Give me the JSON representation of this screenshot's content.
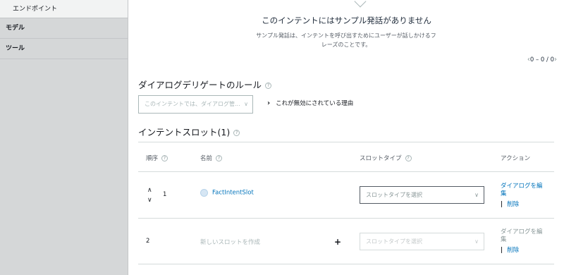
{
  "sidebar": {
    "items": [
      {
        "label": "エンドポイント"
      },
      {
        "label": "モデル"
      },
      {
        "label": "ツール"
      }
    ]
  },
  "empty_state": {
    "title": "このインテントにはサンプル発話がありません",
    "description": "サンプル発話は、インテントを呼び出すためにユーザーが話しかけるフレーズのことです。"
  },
  "pager": {
    "text": "0 – 0 / 0"
  },
  "dialog": {
    "title": "ダイアログデリゲートのルール",
    "select_placeholder": "このインテントでは、ダイアログ管...",
    "reason_label": "これが無効にされている理由"
  },
  "slots": {
    "title": "インテントスロット(1)",
    "headers": {
      "order": "順序",
      "name": "名前",
      "type": "スロットタイプ",
      "actions": "アクション"
    },
    "rows": [
      {
        "order": "1",
        "name": "FactIntentSlot",
        "type_placeholder": "スロットタイプを選択",
        "edit": "ダイアログを編集",
        "delete": "削除"
      },
      {
        "order": "2",
        "name": "新しいスロットを作成",
        "type_placeholder": "スロットタイプを選択",
        "edit": "ダイアログを編集",
        "delete": "削除"
      }
    ]
  },
  "icons": {
    "help": "?",
    "caret": "∨",
    "up": "∧",
    "down": "∨",
    "plus": "+",
    "reason_arrow": "›"
  },
  "colors": {
    "link": "#0073bb",
    "sidebar_bg": "#d5d7d8"
  }
}
